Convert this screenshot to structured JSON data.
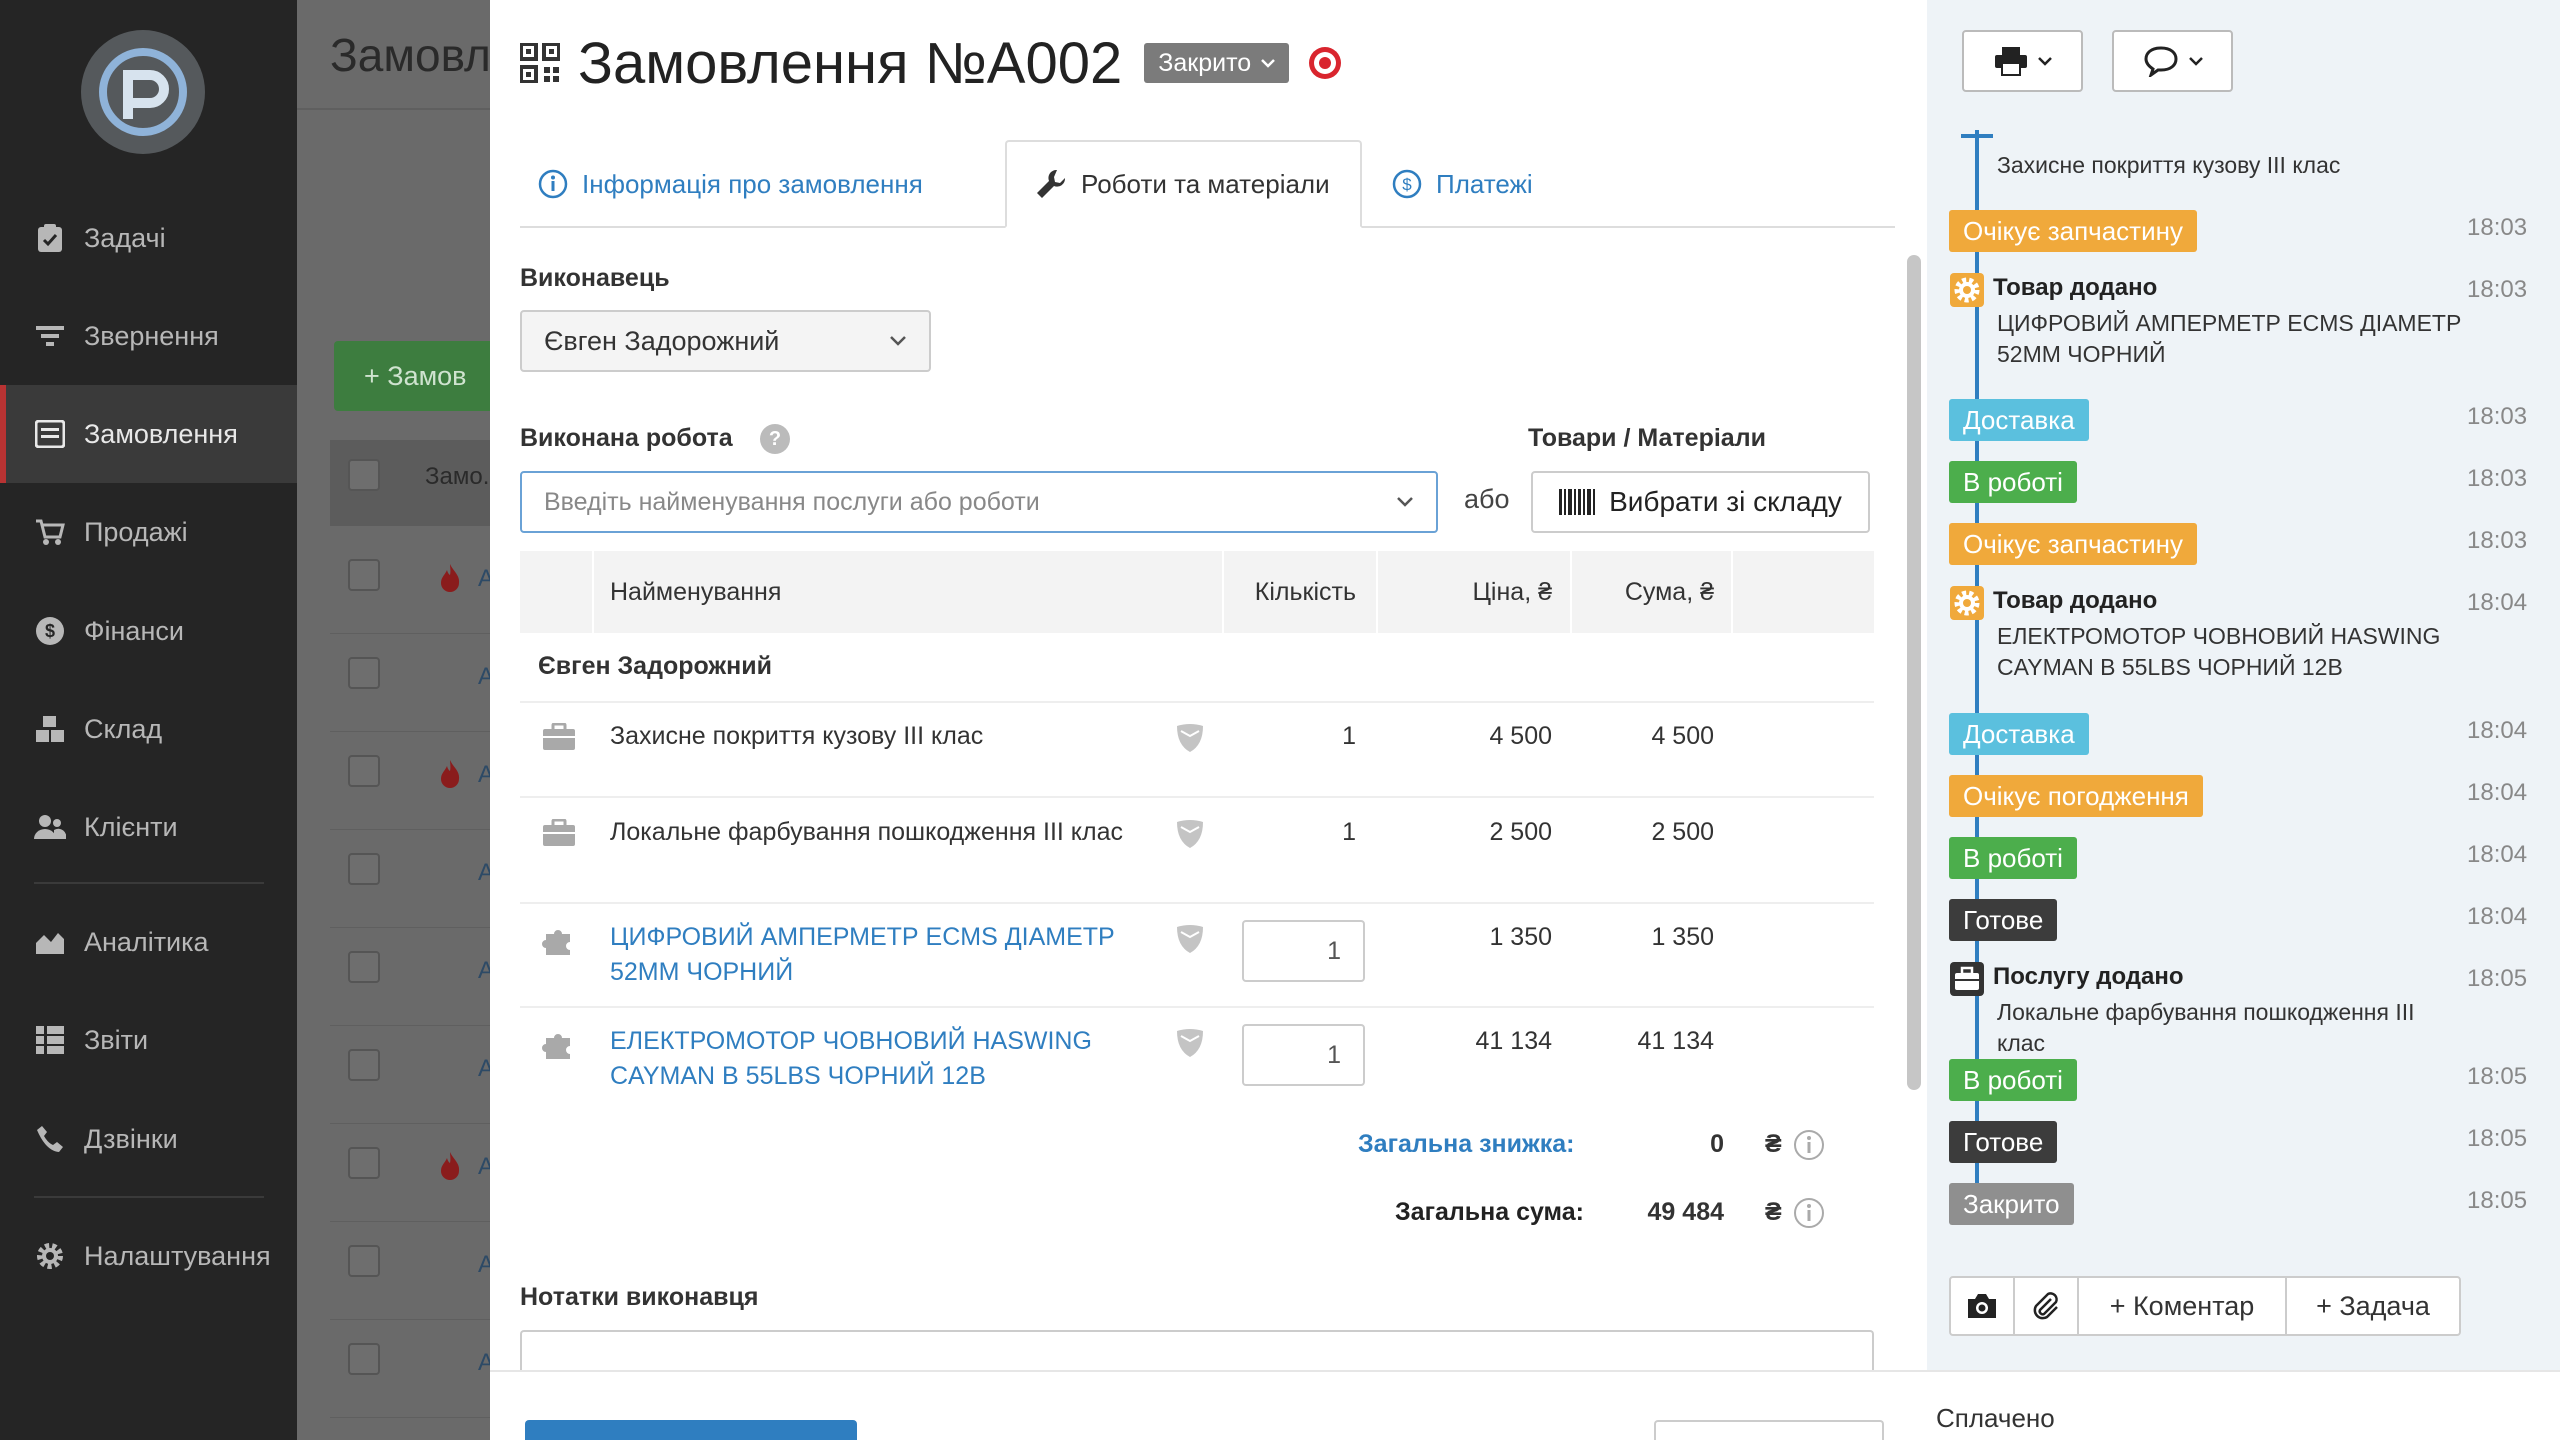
{
  "sidebar": {
    "items": [
      {
        "label": "Задачі",
        "icon": "clipboard-check-icon"
      },
      {
        "label": "Звернення",
        "icon": "filter-icon"
      },
      {
        "label": "Замовлення",
        "icon": "order-list-icon",
        "active": true
      },
      {
        "label": "Продажі",
        "icon": "cart-icon"
      },
      {
        "label": "Фінанси",
        "icon": "dollar-circle-icon"
      },
      {
        "label": "Склад",
        "icon": "boxes-icon"
      },
      {
        "label": "Клієнти",
        "icon": "users-icon"
      },
      {
        "label": "Аналітика",
        "icon": "area-chart-icon"
      },
      {
        "label": "Звіти",
        "icon": "list-report-icon"
      },
      {
        "label": "Дзвінки",
        "icon": "phone-icon"
      },
      {
        "label": "Налаштування",
        "icon": "gear-icon"
      }
    ]
  },
  "background": {
    "title": "Замовл",
    "new_button": "+ Замов",
    "header_col": "Замо.",
    "rows_links": [
      "A",
      "A",
      "A",
      "A",
      "A",
      "A",
      "A",
      "A",
      "A"
    ]
  },
  "modal": {
    "title": "Замовлення №A002",
    "status": "Закрито",
    "tabs": [
      {
        "label": "Інформація про замовлення",
        "icon": "info-circle-icon"
      },
      {
        "label": "Роботи та матеріали",
        "icon": "wrench-icon",
        "active": true
      },
      {
        "label": "Платежі",
        "icon": "dollar-circle-icon"
      }
    ],
    "performer_label": "Виконавець",
    "performer_value": "Євген Задорожний",
    "work_label": "Виконана робота",
    "work_placeholder": "Введіть найменування послуги або роботи",
    "or_text": "або",
    "goods_label": "Товари / Матеріали",
    "stock_button": "Вибрати зі складу",
    "table": {
      "headers": {
        "name": "Найменування",
        "qty": "Кількість",
        "price": "Ціна, ₴",
        "sum": "Сума, ₴"
      },
      "group": "Євген Задорожний",
      "rows": [
        {
          "type": "service",
          "name": "Захисне покриття кузову III клас",
          "qty": "1",
          "price": "4 500",
          "sum": "4 500"
        },
        {
          "type": "service",
          "name": "Локальне фарбування пошкодження III клас",
          "qty": "1",
          "price": "2 500",
          "sum": "2 500"
        },
        {
          "type": "product",
          "name": "ЦИФРОВИЙ АМПЕРМЕТР ECMS ДІАМЕТР 52ММ ЧОРНИЙ",
          "qty": "1",
          "price": "1 350",
          "sum": "1 350"
        },
        {
          "type": "product",
          "name": "ЕЛЕКТРОМОТОР ЧОВНОВИЙ HASWING CAYMAN B 55LBS ЧОРНИЙ 12В",
          "qty": "1",
          "price": "41 134",
          "sum": "41 134"
        }
      ]
    },
    "discount_label": "Загальна знижка:",
    "discount_value": "0",
    "total_label": "Загальна сума:",
    "total_value": "49 484",
    "currency": "₴",
    "notes_label": "Нотатки виконавця",
    "paid_label": "Сплачено"
  },
  "timeline": {
    "events": [
      {
        "kind": "text",
        "text": "Захисне покриття кузову III клас"
      },
      {
        "kind": "status",
        "label": "Очікує запчастину",
        "color": "#f0a93b",
        "time": "18:03"
      },
      {
        "kind": "event",
        "title": "Товар додано",
        "text": "ЦИФРОВИЙ АМПЕРМЕТР ECMS ДІАМЕТР 52ММ ЧОРНИЙ",
        "time": "18:03",
        "icon": "gear-icon"
      },
      {
        "kind": "status",
        "label": "Доставка",
        "color": "#5bc0de",
        "time": "18:03"
      },
      {
        "kind": "status",
        "label": "В роботі",
        "color": "#4cae4c",
        "time": "18:03"
      },
      {
        "kind": "status",
        "label": "Очікує запчастину",
        "color": "#f0a93b",
        "time": "18:03"
      },
      {
        "kind": "event",
        "title": "Товар додано",
        "text": "ЕЛЕКТРОМОТОР ЧОВНОВИЙ HASWING CAYMAN B 55LBS ЧОРНИЙ 12В",
        "time": "18:04",
        "icon": "gear-icon"
      },
      {
        "kind": "status",
        "label": "Доставка",
        "color": "#5bc0de",
        "time": "18:04"
      },
      {
        "kind": "status",
        "label": "Очікує погодження",
        "color": "#f0a93b",
        "time": "18:04"
      },
      {
        "kind": "status",
        "label": "В роботі",
        "color": "#4cae4c",
        "time": "18:04"
      },
      {
        "kind": "status",
        "label": "Готове",
        "color": "#3c3c3c",
        "time": "18:04"
      },
      {
        "kind": "event",
        "title": "Послугу додано",
        "text": "Локальне фарбування пошкодження III клас",
        "time": "18:05",
        "icon": "briefcase-icon"
      },
      {
        "kind": "status",
        "label": "В роботі",
        "color": "#4cae4c",
        "time": "18:05"
      },
      {
        "kind": "status",
        "label": "Готове",
        "color": "#3c3c3c",
        "time": "18:05"
      },
      {
        "kind": "status",
        "label": "Закрито",
        "color": "#8f8f8f",
        "time": "18:05"
      }
    ],
    "actions": {
      "comment": "+ Коментар",
      "task": "+ Задача"
    }
  }
}
